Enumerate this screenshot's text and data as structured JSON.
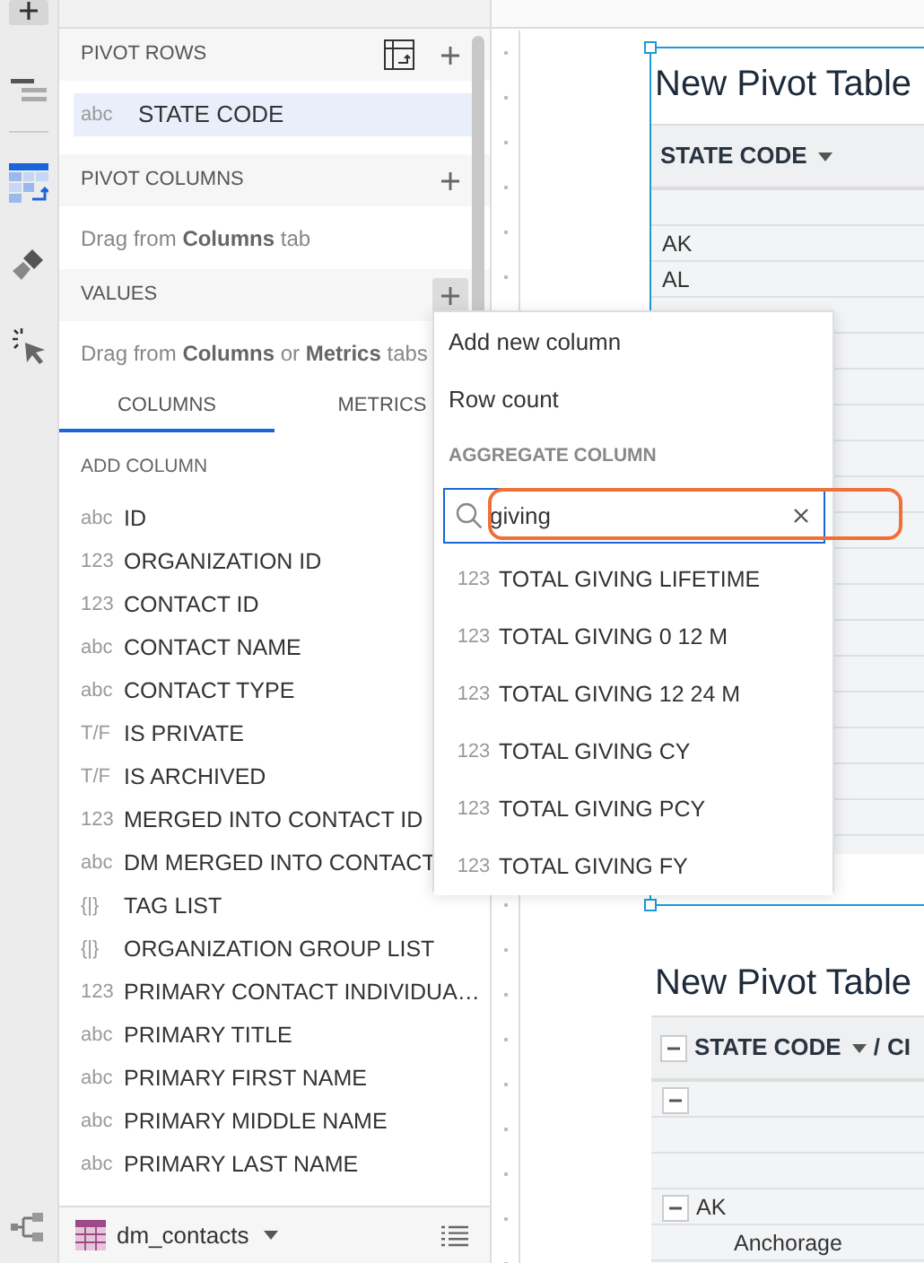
{
  "panel": {
    "sections": [
      {
        "kind": "rows",
        "title": "PIVOT ROWS",
        "active": false,
        "fields": [
          {
            "type": "abc",
            "name": "STATE CODE",
            "selected": true
          }
        ]
      },
      {
        "kind": "columns",
        "title": "PIVOT COLUMNS",
        "active": false,
        "hint": "Drag from **Columns** tab"
      },
      {
        "kind": "values",
        "title": "VALUES",
        "active": true,
        "hint": "Drag from **Columns** or **Metrics** tabs"
      }
    ],
    "tabs": [
      {
        "label": "COLUMNS",
        "selected": true
      },
      {
        "label": "METRICS",
        "selected": false
      }
    ],
    "list_label": "ADD COLUMN",
    "columns": [
      {
        "type": "abc",
        "name": "ID"
      },
      {
        "type": "123",
        "name": "ORGANIZATION ID"
      },
      {
        "type": "123",
        "name": "CONTACT ID"
      },
      {
        "type": "abc",
        "name": "CONTACT NAME"
      },
      {
        "type": "abc",
        "name": "CONTACT TYPE"
      },
      {
        "type": "T/F",
        "name": "IS PRIVATE"
      },
      {
        "type": "T/F",
        "name": "IS ARCHIVED"
      },
      {
        "type": "123",
        "name": "MERGED INTO CONTACT ID"
      },
      {
        "type": "abc",
        "name": "DM MERGED INTO CONTACT"
      },
      {
        "type": "{|}",
        "name": "TAG LIST"
      },
      {
        "type": "{|}",
        "name": "ORGANIZATION GROUP LIST"
      },
      {
        "type": "123",
        "name": "PRIMARY CONTACT INDIVIDUA…"
      },
      {
        "type": "abc",
        "name": "PRIMARY TITLE"
      },
      {
        "type": "abc",
        "name": "PRIMARY FIRST NAME"
      },
      {
        "type": "abc",
        "name": "PRIMARY MIDDLE NAME"
      },
      {
        "type": "abc",
        "name": "PRIMARY LAST NAME"
      }
    ],
    "source": {
      "name": "dm_contacts"
    }
  },
  "menu": {
    "items": [
      "Add new column",
      "Row count"
    ],
    "group_label": "AGGREGATE COLUMN",
    "search": {
      "value": "giving",
      "highlighted": true
    },
    "results": [
      {
        "type": "123",
        "name": "TOTAL GIVING LIFETIME"
      },
      {
        "type": "123",
        "name": "TOTAL GIVING 0 12 M"
      },
      {
        "type": "123",
        "name": "TOTAL GIVING 12 24 M"
      },
      {
        "type": "123",
        "name": "TOTAL GIVING CY"
      },
      {
        "type": "123",
        "name": "TOTAL GIVING PCY"
      },
      {
        "type": "123",
        "name": "TOTAL GIVING FY"
      }
    ]
  },
  "pivots": [
    {
      "title": "New Pivot Table",
      "selected": true,
      "header": {
        "collapsible": false,
        "label": "STATE CODE"
      },
      "rows": [
        {
          "kind": "blank"
        },
        {
          "kind": "leaf",
          "label": "AK"
        },
        {
          "kind": "leaf",
          "label": "AL"
        }
      ]
    },
    {
      "title": "New Pivot Table",
      "selected": false,
      "header": {
        "collapsible": true,
        "label": "STATE CODE",
        "separator": "/",
        "next": "CI"
      },
      "rows": [
        {
          "kind": "group"
        },
        {
          "kind": "blank"
        },
        {
          "kind": "blank"
        },
        {
          "kind": "group",
          "label": "AK",
          "children": [
            {
              "kind": "leaf",
              "label": "Anchorage"
            }
          ]
        }
      ]
    }
  ]
}
